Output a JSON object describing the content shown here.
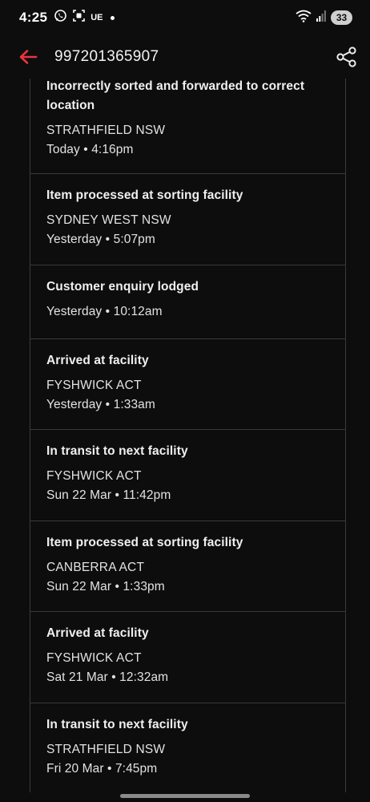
{
  "status_bar": {
    "time": "4:25",
    "carrier_text": "UE",
    "battery": "33"
  },
  "header": {
    "title": "997201365907",
    "accent_color": "#e8343e"
  },
  "events": [
    {
      "title": "Incorrectly sorted and forwarded to correct location",
      "location": "STRATHFIELD NSW",
      "time": "Today • 4:16pm"
    },
    {
      "title": "Item processed at sorting facility",
      "location": "SYDNEY WEST NSW",
      "time": "Yesterday • 5:07pm"
    },
    {
      "title": "Customer enquiry lodged",
      "location": "",
      "time": "Yesterday • 10:12am"
    },
    {
      "title": "Arrived at facility",
      "location": "FYSHWICK ACT",
      "time": "Yesterday • 1:33am"
    },
    {
      "title": "In transit to next facility",
      "location": "FYSHWICK ACT",
      "time": "Sun 22 Mar • 11:42pm"
    },
    {
      "title": "Item processed at sorting facility",
      "location": "CANBERRA ACT",
      "time": "Sun 22 Mar • 1:33pm"
    },
    {
      "title": "Arrived at facility",
      "location": "FYSHWICK ACT",
      "time": "Sat 21 Mar • 12:32am"
    },
    {
      "title": "In transit to next facility",
      "location": "STRATHFIELD NSW",
      "time": "Fri 20 Mar • 7:45pm"
    }
  ]
}
